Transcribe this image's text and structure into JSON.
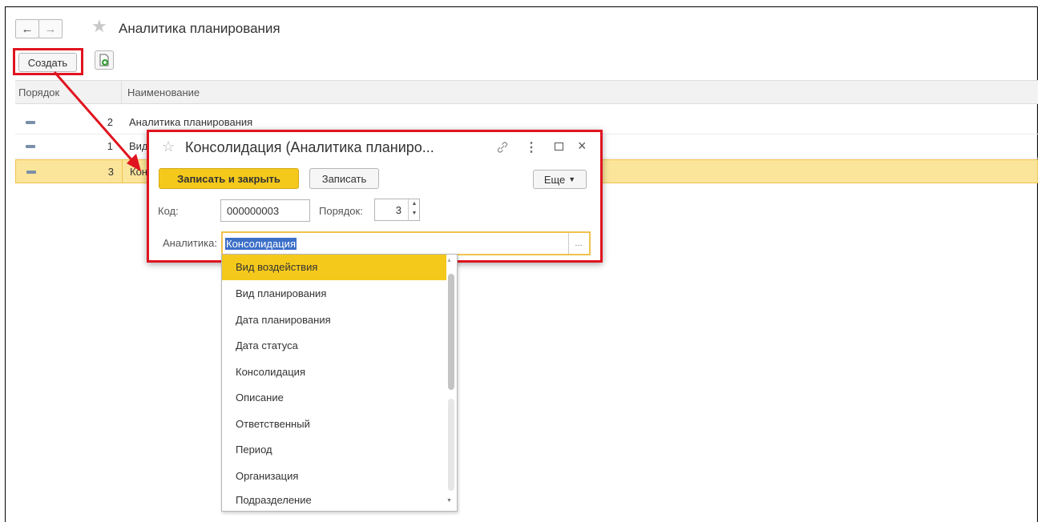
{
  "window": {
    "title": "Аналитика планирования",
    "back_icon": "arrow-left",
    "forward_icon": "arrow-right",
    "favorite_icon": "star"
  },
  "toolbar": {
    "create_label": "Создать",
    "copy_icon": "add-document"
  },
  "table": {
    "columns": [
      "Порядок",
      "Наименование"
    ],
    "rows": [
      {
        "order": "2",
        "name": "Аналитика планирования",
        "selected": false
      },
      {
        "order": "1",
        "name": "Вид",
        "selected": false
      },
      {
        "order": "3",
        "name": "Кон",
        "selected": true
      }
    ]
  },
  "dialog": {
    "title": "Консолидация (Аналитика планиро...",
    "save_close_label": "Записать и закрыть",
    "save_label": "Записать",
    "more_label": "Еще",
    "code_label": "Код:",
    "code_value": "000000003",
    "order_label": "Порядок:",
    "order_value": "3",
    "analytics_label": "Аналитика:",
    "analytics_value": "Консолидация",
    "choose_label": "..."
  },
  "dropdown": {
    "items": [
      "Вид воздействия",
      "Вид планирования",
      "Дата планирования",
      "Дата статуса",
      "Консолидация",
      "Описание",
      "Ответственный",
      "Период",
      "Организация",
      "Подразделение"
    ],
    "highlighted_index": 0
  },
  "colors": {
    "accent_yellow": "#f5c91c",
    "selected_row": "#fbe59a",
    "annotation_red": "#e0141f"
  }
}
